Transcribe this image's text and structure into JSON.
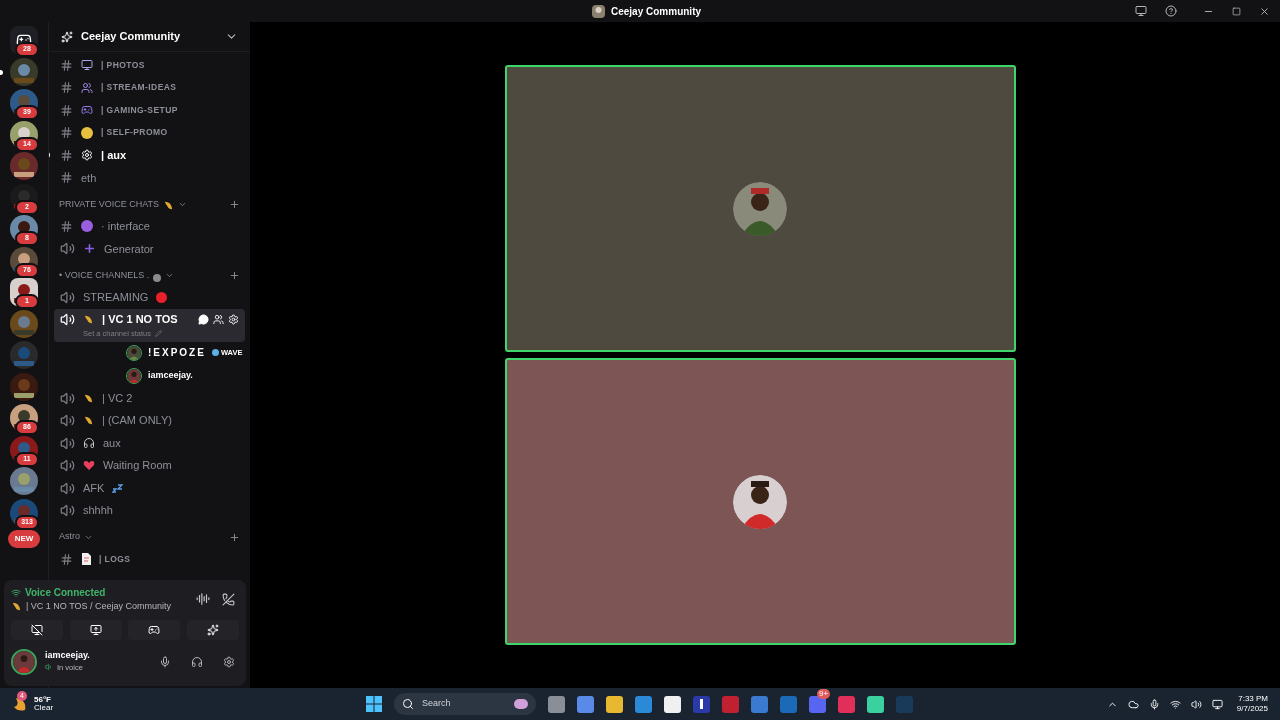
{
  "window": {
    "title": "Ceejay Community"
  },
  "servers": [
    {
      "kind": "home",
      "badge": "28",
      "unread": false
    },
    {
      "kind": "server",
      "unread": true
    },
    {
      "kind": "server",
      "badge": "39",
      "unread": false
    },
    {
      "kind": "server",
      "badge": "14",
      "unread": false
    },
    {
      "kind": "server",
      "unread": false
    },
    {
      "kind": "server",
      "badge": "2",
      "unread": false
    },
    {
      "kind": "server",
      "badge": "8",
      "unread": false
    },
    {
      "kind": "server",
      "badge": "76",
      "unread": false
    },
    {
      "kind": "server",
      "badge": "1",
      "unread": false
    },
    {
      "kind": "server",
      "unread": false
    },
    {
      "kind": "server",
      "unread": false
    },
    {
      "kind": "server",
      "unread": false
    },
    {
      "kind": "server",
      "badge": "86",
      "unread": false
    },
    {
      "kind": "server",
      "badge": "11",
      "unread": false
    },
    {
      "kind": "server",
      "unread": false
    },
    {
      "kind": "server",
      "badge": "313",
      "unread": false
    },
    {
      "kind": "new",
      "badge": "NEW",
      "unread": false
    }
  ],
  "server_header": {
    "name": "Ceejay Community"
  },
  "sections": [
    {
      "channels": [
        {
          "kind": "text",
          "name": "| PHOTOS",
          "unread": false,
          "selected": false
        },
        {
          "kind": "text",
          "name": "| STREAM-IDEAS",
          "unread": false,
          "selected": false
        },
        {
          "kind": "text",
          "name": "| GAMING-SETUP",
          "unread": false,
          "selected": false
        },
        {
          "kind": "text",
          "name": "| SELF-PROMO",
          "unread": false,
          "selected": false
        },
        {
          "kind": "text",
          "name": "| aux",
          "unread": true,
          "selected": false
        },
        {
          "kind": "text",
          "name": "eth",
          "unread": false,
          "selected": false
        }
      ]
    },
    {
      "title": "PRIVATE VOICE CHATS",
      "channels": [
        {
          "kind": "text",
          "name": "· interface",
          "unread": false,
          "selected": false
        },
        {
          "kind": "voice",
          "name": "Generator",
          "unread": false,
          "selected": false
        }
      ]
    },
    {
      "title": "• VOICE CHANNELS .",
      "channels": [
        {
          "kind": "voice",
          "name": "STREAMING",
          "unread": false,
          "selected": false
        },
        {
          "kind": "voice",
          "name": "| VC 1 NO TOS",
          "unread": false,
          "selected": true,
          "status": "Set a channel status",
          "members": [
            {
              "name": "!EXPOZE",
              "tag": "WAVE"
            },
            {
              "name": "iamceejay."
            }
          ]
        },
        {
          "kind": "voice",
          "name": "| VC 2",
          "unread": false,
          "selected": false
        },
        {
          "kind": "voice",
          "name": "| (CAM ONLY)",
          "unread": false,
          "selected": false
        },
        {
          "kind": "voice",
          "name": "aux",
          "unread": false,
          "selected": false
        },
        {
          "kind": "voice",
          "name": "Waiting Room",
          "unread": false,
          "selected": false
        },
        {
          "kind": "voice",
          "name": "AFK",
          "unread": false,
          "selected": false
        },
        {
          "kind": "voice",
          "name": "shhhh",
          "unread": false,
          "selected": false
        }
      ]
    },
    {
      "title": "Astro",
      "channels": [
        {
          "kind": "text",
          "name": "| LOGS",
          "unread": false,
          "selected": false
        }
      ]
    }
  ],
  "voice_panel": {
    "status": "Voice Connected",
    "channel": "| VC 1 NO TOS / Ceejay Community"
  },
  "user": {
    "name": "iamceejay.",
    "status": "In voice"
  },
  "tiles": [
    {
      "color": "#4f4a3f",
      "speaking": true
    },
    {
      "color": "#7d5555",
      "speaking": true
    }
  ],
  "taskbar": {
    "weather": {
      "temp": "56°F",
      "condition": "Clear",
      "badge": "4"
    },
    "search": {
      "placeholder": "Search"
    },
    "discord_badge": "9+",
    "time": "7:33 PM",
    "date": "9/7/2025"
  }
}
